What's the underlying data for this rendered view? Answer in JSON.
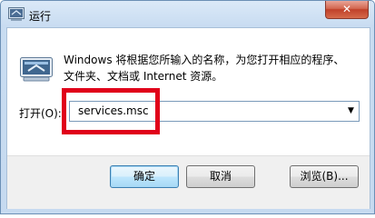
{
  "window": {
    "title": "运行",
    "close_glyph": "✕"
  },
  "content": {
    "description_line1": "Windows 将根据您所输入的名称，为您打开相应的程序、",
    "description_line2": "文件夹、文档或 Internet 资源。",
    "open_label": "打开(O):",
    "open_value": "services.msc",
    "dropdown_arrow": "▼"
  },
  "buttons": {
    "ok": "确定",
    "cancel": "取消",
    "browse": "浏览(B)..."
  },
  "colors": {
    "highlight": "#e0001a",
    "title_bar": "#c8dcf1",
    "close_button": "#c9452d"
  }
}
